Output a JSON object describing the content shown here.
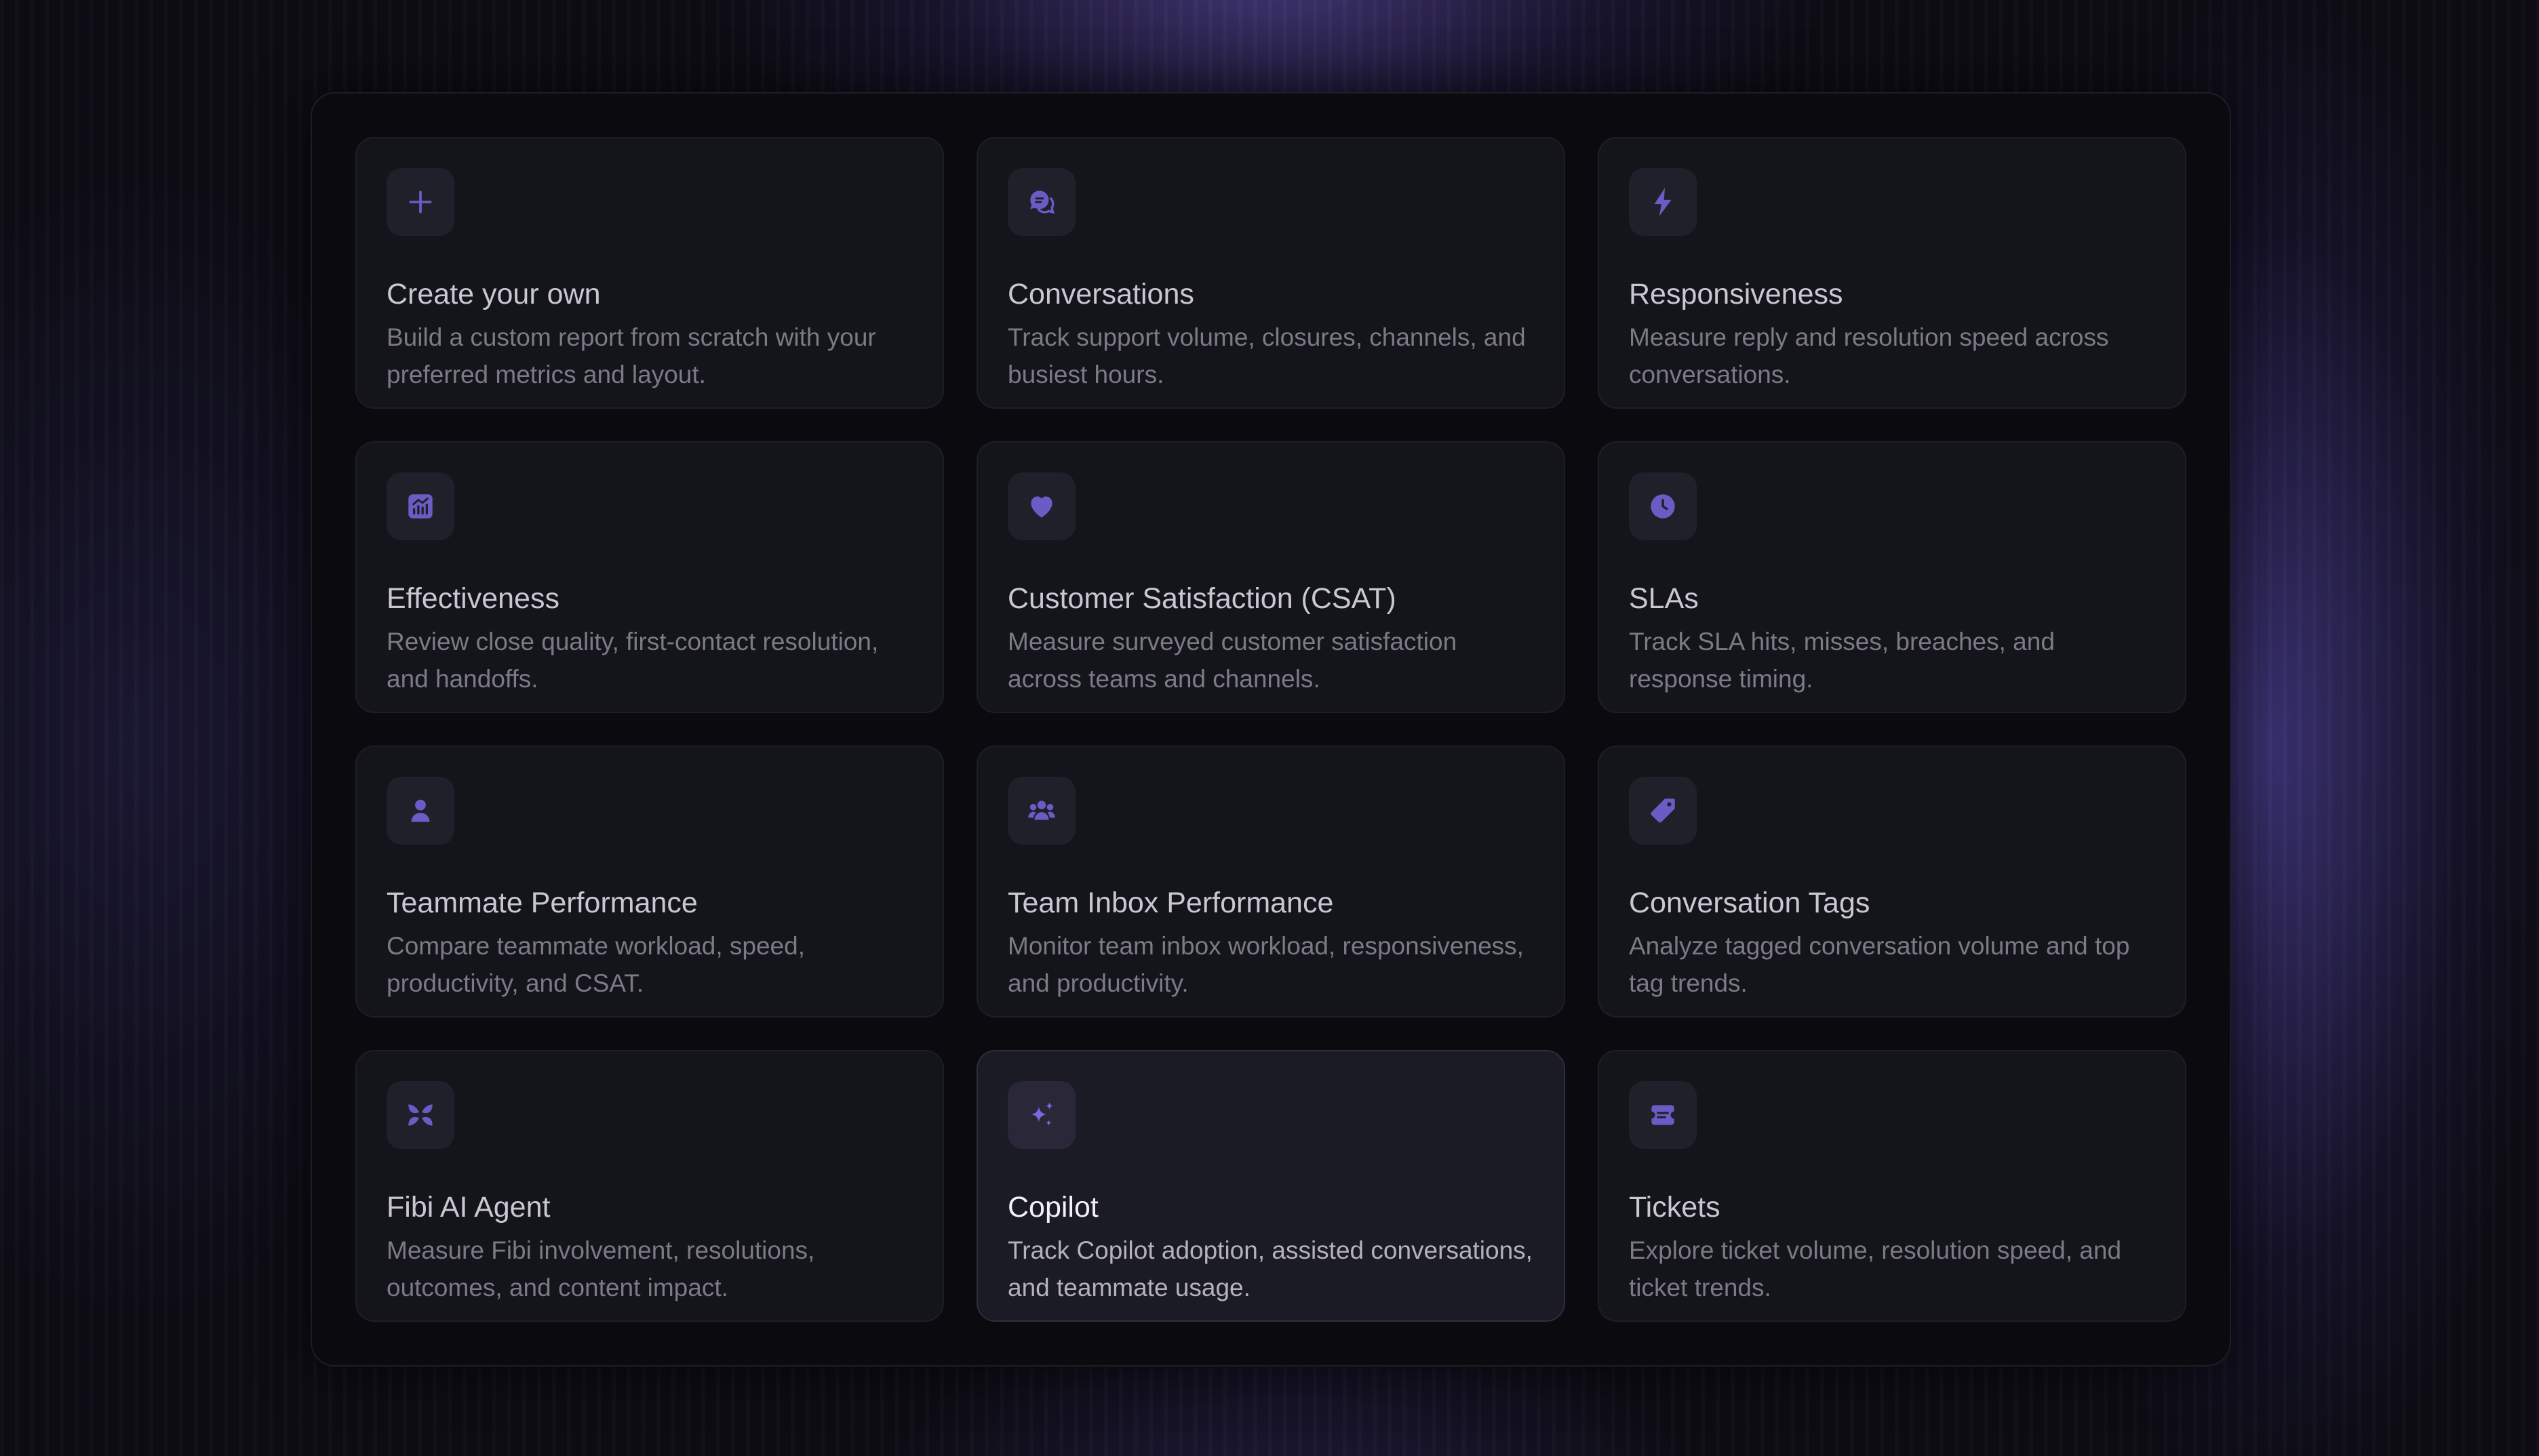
{
  "accent_color": "#6b5bc4",
  "cards": [
    {
      "title": "Create your own",
      "description": "Build a custom report from scratch with your preferred metrics and layout.",
      "icon": "plus-icon"
    },
    {
      "title": "Conversations",
      "description": "Track support volume, closures, channels, and busiest hours.",
      "icon": "chat-bubbles-icon"
    },
    {
      "title": "Responsiveness",
      "description": "Measure reply and resolution speed across conversations.",
      "icon": "lightning-icon"
    },
    {
      "title": "Effectiveness",
      "description": "Review close quality, first-contact resolution, and handoffs.",
      "icon": "chart-icon"
    },
    {
      "title": "Customer Satisfaction (CSAT)",
      "description": "Measure surveyed customer satisfaction across teams and channels.",
      "icon": "heart-icon"
    },
    {
      "title": "SLAs",
      "description": "Track SLA hits, misses, breaches, and response timing.",
      "icon": "clock-icon"
    },
    {
      "title": "Teammate Performance",
      "description": "Compare teammate workload, speed, productivity, and CSAT.",
      "icon": "person-icon"
    },
    {
      "title": "Team Inbox Performance",
      "description": "Monitor team inbox workload, responsiveness, and productivity.",
      "icon": "team-icon"
    },
    {
      "title": "Conversation Tags",
      "description": "Analyze tagged conversation volume and top tag trends.",
      "icon": "tag-icon"
    },
    {
      "title": "Fibi AI Agent",
      "description": "Measure Fibi involvement, resolutions, outcomes, and content impact.",
      "icon": "fibi-logo-icon"
    },
    {
      "title": "Copilot",
      "description": "Track Copilot adoption, assisted conversations, and teammate usage.",
      "icon": "sparkles-icon"
    },
    {
      "title": "Tickets",
      "description": "Explore ticket volume, resolution speed, and ticket trends.",
      "icon": "ticket-icon"
    }
  ]
}
